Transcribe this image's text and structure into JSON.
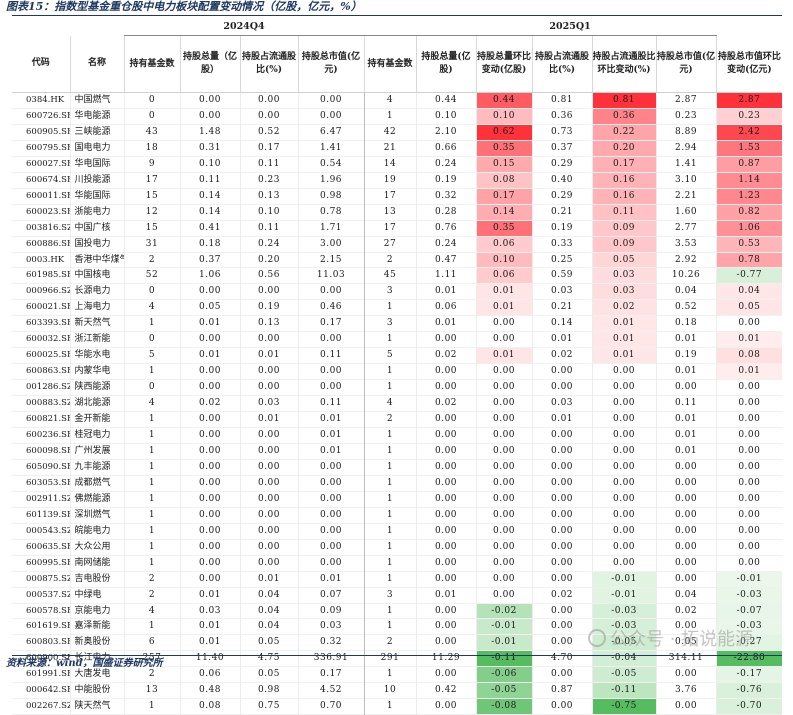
{
  "title": "图表15：指数型基金重仓股中电力板块配置变动情况（亿股，亿元，%）",
  "source": "资料来源：wind，国盛证券研究所",
  "watermark": "公众号 · 拓说能源",
  "colors": {
    "neg_max": "#5cb85c",
    "pos_max": "#e8303c"
  },
  "groups": [
    {
      "label": "",
      "span": 2
    },
    {
      "label": "2024Q4",
      "span": 4
    },
    {
      "label": "2025Q1",
      "span": 6
    }
  ],
  "columns": [
    "代码",
    "名称",
    "持有基金数",
    "持股总量（亿股）",
    "持股占流通股比(%)",
    "持股总市值(亿元)",
    "持有基金数",
    "持股总量(亿股)",
    "持股总量环比变动(亿股)",
    "持股占流通股比(%)",
    "持股占流通股比环比变动(%)",
    "持股总市值(亿元)",
    "持股总市值环比变动(亿元)"
  ],
  "rows": [
    [
      "0384.HK",
      "中国燃气",
      "0",
      "0.00",
      "0.00",
      "0.00",
      "4",
      "0.44",
      "0.44",
      "0.81",
      "0.81",
      "2.87",
      "2.87"
    ],
    [
      "600726.SH",
      "华电能源",
      "0",
      "0.00",
      "0.00",
      "0.00",
      "1",
      "0.10",
      "0.10",
      "0.36",
      "0.36",
      "0.23",
      "0.23"
    ],
    [
      "600905.SH",
      "三峡能源",
      "43",
      "1.48",
      "0.52",
      "6.47",
      "42",
      "2.10",
      "0.62",
      "0.73",
      "0.22",
      "8.89",
      "2.42"
    ],
    [
      "600795.SH",
      "国电电力",
      "18",
      "0.31",
      "0.17",
      "1.41",
      "21",
      "0.66",
      "0.35",
      "0.37",
      "0.20",
      "2.94",
      "1.53"
    ],
    [
      "600027.SH",
      "华电国际",
      "9",
      "0.10",
      "0.11",
      "0.54",
      "14",
      "0.24",
      "0.15",
      "0.29",
      "0.17",
      "1.41",
      "0.87"
    ],
    [
      "600674.SH",
      "川投能源",
      "17",
      "0.11",
      "0.23",
      "1.96",
      "19",
      "0.19",
      "0.08",
      "0.40",
      "0.16",
      "3.10",
      "1.14"
    ],
    [
      "600011.SH",
      "华能国际",
      "15",
      "0.14",
      "0.13",
      "0.98",
      "17",
      "0.32",
      "0.17",
      "0.29",
      "0.16",
      "2.21",
      "1.23"
    ],
    [
      "600023.SH",
      "浙能电力",
      "12",
      "0.14",
      "0.10",
      "0.78",
      "13",
      "0.28",
      "0.14",
      "0.21",
      "0.11",
      "1.60",
      "0.82"
    ],
    [
      "003816.SZ",
      "中国广核",
      "15",
      "0.41",
      "0.11",
      "1.71",
      "17",
      "0.76",
      "0.35",
      "0.19",
      "0.09",
      "2.77",
      "1.06"
    ],
    [
      "600886.SH",
      "国投电力",
      "31",
      "0.18",
      "0.24",
      "3.00",
      "27",
      "0.24",
      "0.06",
      "0.33",
      "0.09",
      "3.53",
      "0.53"
    ],
    [
      "0003.HK",
      "香港中华煤气",
      "2",
      "0.37",
      "0.20",
      "2.15",
      "2",
      "0.47",
      "0.10",
      "0.25",
      "0.05",
      "2.92",
      "0.78"
    ],
    [
      "601985.SH",
      "中国核电",
      "52",
      "1.06",
      "0.56",
      "11.03",
      "45",
      "1.11",
      "0.06",
      "0.59",
      "0.03",
      "10.26",
      "-0.77"
    ],
    [
      "000966.SZ",
      "长源电力",
      "0",
      "0.00",
      "0.00",
      "0.00",
      "3",
      "0.01",
      "0.01",
      "0.03",
      "0.03",
      "0.04",
      "0.04"
    ],
    [
      "600021.SH",
      "上海电力",
      "4",
      "0.05",
      "0.19",
      "0.46",
      "1",
      "0.06",
      "0.01",
      "0.21",
      "0.02",
      "0.52",
      "0.05"
    ],
    [
      "603393.SH",
      "新天然气",
      "1",
      "0.01",
      "0.13",
      "0.17",
      "3",
      "0.01",
      "0.00",
      "0.14",
      "0.01",
      "0.18",
      "0.00"
    ],
    [
      "600032.SH",
      "浙江新能",
      "0",
      "0.00",
      "0.00",
      "0.00",
      "1",
      "0.00",
      "0.00",
      "0.01",
      "0.01",
      "0.01",
      "0.01"
    ],
    [
      "600025.SH",
      "华能水电",
      "5",
      "0.01",
      "0.01",
      "0.11",
      "5",
      "0.02",
      "0.01",
      "0.02",
      "0.01",
      "0.19",
      "0.08"
    ],
    [
      "600863.SH",
      "内蒙华电",
      "1",
      "0.00",
      "0.00",
      "0.00",
      "1",
      "0.00",
      "0.00",
      "0.00",
      "0.00",
      "0.01",
      "0.01"
    ],
    [
      "001286.SZ",
      "陕西能源",
      "0",
      "0.00",
      "0.00",
      "0.00",
      "1",
      "0.00",
      "0.00",
      "0.00",
      "0.00",
      "0.00",
      "0.00"
    ],
    [
      "000883.SZ",
      "湖北能源",
      "4",
      "0.02",
      "0.03",
      "0.11",
      "4",
      "0.02",
      "0.00",
      "0.03",
      "0.00",
      "0.11",
      "0.00"
    ],
    [
      "600821.SH",
      "金开新能",
      "1",
      "0.00",
      "0.01",
      "0.01",
      "2",
      "0.00",
      "0.00",
      "0.01",
      "0.00",
      "0.01",
      "0.00"
    ],
    [
      "600236.SH",
      "桂冠电力",
      "1",
      "0.00",
      "0.00",
      "0.01",
      "1",
      "0.00",
      "0.00",
      "0.00",
      "0.00",
      "0.01",
      "0.00"
    ],
    [
      "600098.SH",
      "广州发展",
      "1",
      "0.00",
      "0.00",
      "0.01",
      "1",
      "0.00",
      "0.00",
      "0.00",
      "0.00",
      "0.01",
      "0.00"
    ],
    [
      "605090.SH",
      "九丰能源",
      "1",
      "0.00",
      "0.00",
      "0.00",
      "1",
      "0.00",
      "0.00",
      "0.00",
      "0.00",
      "0.00",
      "0.00"
    ],
    [
      "603053.SH",
      "成都燃气",
      "1",
      "0.00",
      "0.00",
      "0.00",
      "1",
      "0.00",
      "0.00",
      "0.00",
      "0.00",
      "0.00",
      "0.00"
    ],
    [
      "002911.SZ",
      "佛燃能源",
      "1",
      "0.00",
      "0.00",
      "0.00",
      "1",
      "0.00",
      "0.00",
      "0.00",
      "0.00",
      "0.00",
      "0.00"
    ],
    [
      "601139.SH",
      "深圳燃气",
      "1",
      "0.00",
      "0.00",
      "0.00",
      "1",
      "0.00",
      "0.00",
      "0.00",
      "0.00",
      "0.00",
      "0.00"
    ],
    [
      "000543.SZ",
      "皖能电力",
      "1",
      "0.00",
      "0.00",
      "0.00",
      "1",
      "0.00",
      "0.00",
      "0.00",
      "0.00",
      "0.00",
      "0.00"
    ],
    [
      "600635.SH",
      "大众公用",
      "1",
      "0.00",
      "0.00",
      "0.00",
      "1",
      "0.00",
      "0.00",
      "0.00",
      "0.00",
      "0.00",
      "0.00"
    ],
    [
      "600995.SH",
      "南网储能",
      "1",
      "0.00",
      "0.00",
      "0.00",
      "1",
      "0.00",
      "0.00",
      "0.00",
      "0.00",
      "0.00",
      "0.00"
    ],
    [
      "000875.SZ",
      "吉电股份",
      "2",
      "0.00",
      "0.01",
      "0.01",
      "1",
      "0.00",
      "0.00",
      "0.00",
      "-0.01",
      "0.00",
      "-0.01"
    ],
    [
      "000537.SZ",
      "中绿电",
      "2",
      "0.01",
      "0.04",
      "0.07",
      "3",
      "0.01",
      "0.00",
      "0.02",
      "-0.01",
      "0.04",
      "-0.03"
    ],
    [
      "600578.SH",
      "京能电力",
      "4",
      "0.03",
      "0.04",
      "0.09",
      "1",
      "0.00",
      "-0.02",
      "0.00",
      "-0.03",
      "0.02",
      "-0.07"
    ],
    [
      "601619.SH",
      "嘉泽新能",
      "1",
      "0.01",
      "0.04",
      "0.03",
      "1",
      "0.00",
      "-0.01",
      "0.00",
      "-0.03",
      "0.00",
      "-0.03"
    ],
    [
      "600803.SH",
      "新奥股份",
      "6",
      "0.01",
      "0.05",
      "0.32",
      "2",
      "0.00",
      "-0.01",
      "0.00",
      "-0.05",
      "0.05",
      "-0.27"
    ],
    [
      "600900.SH",
      "长江电力",
      "257",
      "11.40",
      "4.75",
      "336.91",
      "291",
      "11.29",
      "-0.11",
      "4.70",
      "-0.04",
      "314.11",
      "-22.80"
    ],
    [
      "601991.SH",
      "大唐发电",
      "2",
      "0.06",
      "0.05",
      "0.17",
      "1",
      "0.00",
      "-0.06",
      "0.00",
      "-0.05",
      "0.00",
      "-0.17"
    ],
    [
      "000642.SH",
      "中能股份",
      "13",
      "0.48",
      "0.98",
      "4.52",
      "10",
      "0.42",
      "-0.05",
      "0.87",
      "-0.11",
      "3.76",
      "-0.76"
    ],
    [
      "002267.SZ",
      "陕天然气",
      "1",
      "0.08",
      "0.75",
      "0.70",
      "1",
      "0.00",
      "-0.08",
      "0.00",
      "-0.75",
      "0.00",
      "-0.70"
    ]
  ]
}
